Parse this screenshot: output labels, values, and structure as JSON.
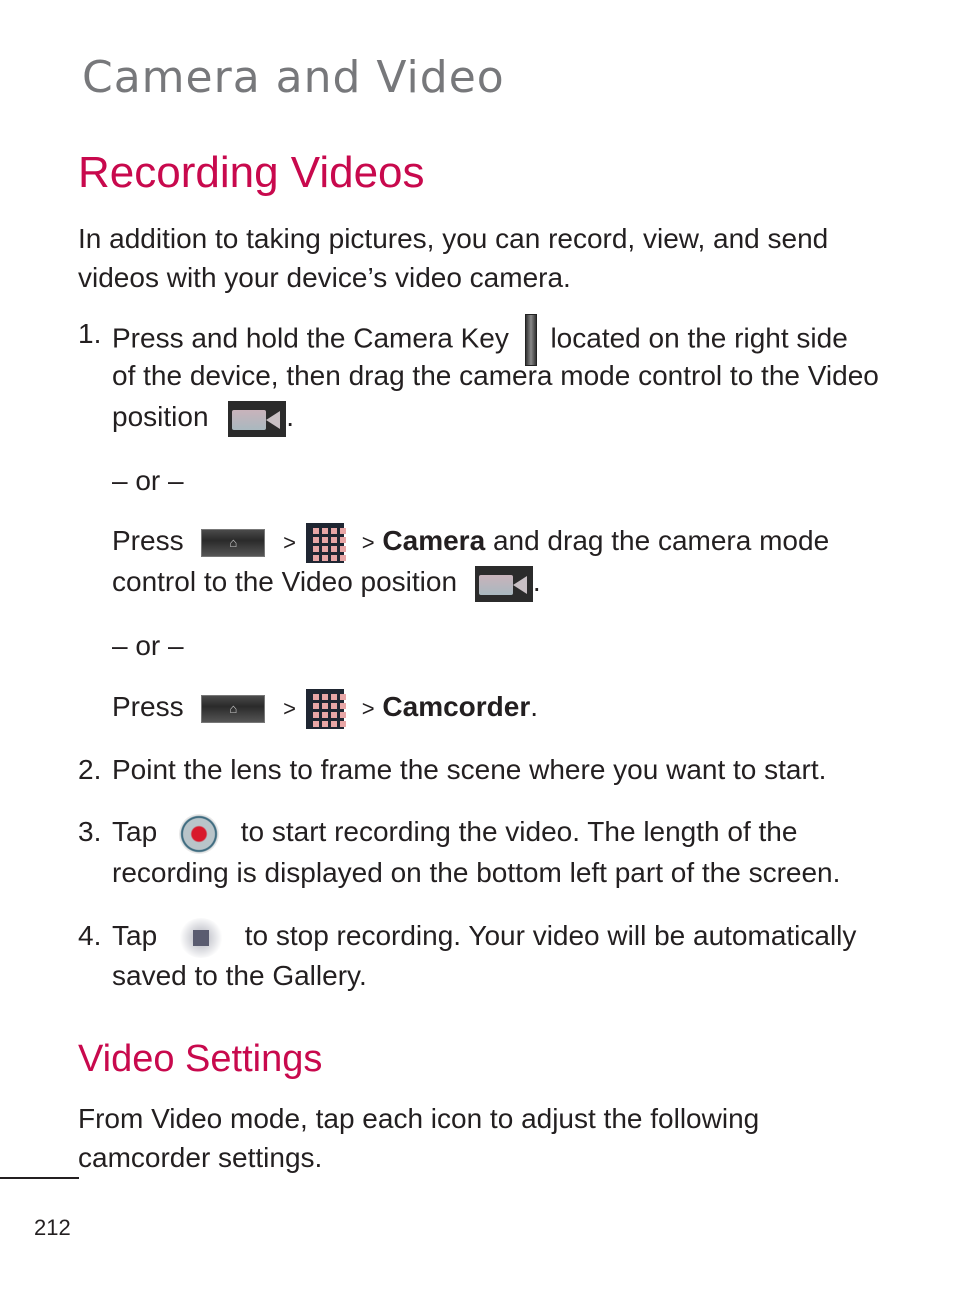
{
  "chapter_title": "Camera and Video",
  "section_title": "Recording Videos",
  "intro": [
    "In addition to taking pictures, you can record, view, and send",
    "videos with your device’s video camera."
  ],
  "steps": [
    {
      "num": "1.",
      "line1a": "Press and hold the Camera Key",
      "line1b": "located on the right side",
      "line2": "of the device, then drag the camera mode control to the Video",
      "line3": "position",
      "punct": "."
    },
    {
      "num": "2.",
      "text": "Point the lens to frame the scene where you want to start."
    },
    {
      "num": "3.",
      "a": "Tap",
      "b": "to start recording the video. The length of the",
      "c": "recording is displayed on the bottom left part of the screen."
    },
    {
      "num": "4.",
      "a": "Tap",
      "b": "to stop recording. Your video will be automatically",
      "c": "saved to the Gallery."
    }
  ],
  "or_text": "– or –",
  "alt1": {
    "press": "Press",
    "gt": ">",
    "gt2": ">",
    "bold": "Camera",
    "rest": "and drag the camera mode",
    "line2": "control to the Video position",
    "punct": "."
  },
  "alt2": {
    "press": "Press",
    "gt": ">",
    "gt2": ">",
    "bold": "Camcorder",
    "punct": "."
  },
  "icons": {
    "home": "⌂"
  },
  "settings_title": "Video Settings",
  "settings_text": [
    "From Video mode, tap each icon to adjust the following",
    "camcorder settings."
  ],
  "page_number": "212"
}
